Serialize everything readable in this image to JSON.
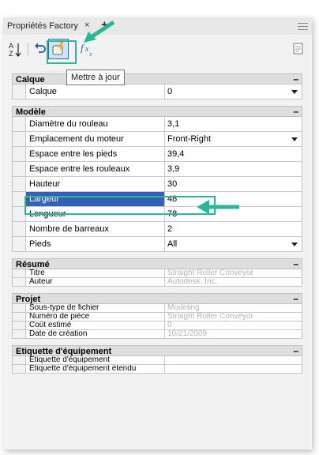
{
  "window": {
    "title": "Propriétés Factory",
    "close": "×",
    "add": "+"
  },
  "toolbar": {
    "sort_label": "A Z",
    "tooltip": "Mettre à jour"
  },
  "sections": [
    {
      "id": "calque",
      "title": "Calque",
      "collapse": "–",
      "rows": [
        {
          "name": "Calque",
          "value": "0",
          "dropdown": true
        }
      ]
    },
    {
      "id": "modele",
      "title": "Modèle",
      "collapse": "–",
      "rows": [
        {
          "name": "Diamètre du rouleau",
          "value": "3,1"
        },
        {
          "name": "Emplacement du moteur",
          "value": "Front-Right",
          "dropdown": true
        },
        {
          "name": "Espace entre les pieds",
          "value": "39,4"
        },
        {
          "name": "Espace entre les rouleaux",
          "value": "3,9"
        },
        {
          "name": "Hauteur",
          "value": "30"
        },
        {
          "name": "Largeur",
          "value": "48",
          "selected": true
        },
        {
          "name": "Longueur",
          "value": "78"
        },
        {
          "name": "Nombre de barreaux",
          "value": "2"
        },
        {
          "name": "Pieds",
          "value": "All",
          "dropdown": true
        }
      ]
    },
    {
      "id": "resume",
      "title": "Résumé",
      "collapse": "–",
      "rows": [
        {
          "name": "Titre",
          "value": "Straight Roller Conveyor",
          "grey": true
        },
        {
          "name": "Auteur",
          "value": "Autodesk, Inc.",
          "grey": true
        }
      ]
    },
    {
      "id": "projet",
      "title": "Projet",
      "collapse": "–",
      "rows": [
        {
          "name": "Sous-type de fichier",
          "value": "Modeling",
          "grey": true
        },
        {
          "name": "Numéro de pièce",
          "value": "Straight Roller Conveyor",
          "grey": true
        },
        {
          "name": "Coût estimé",
          "value": "0",
          "grey": true
        },
        {
          "name": "Date de création",
          "value": "10/21/2009",
          "grey": true
        }
      ]
    },
    {
      "id": "etiquette",
      "title": "Etiquette d'équipement",
      "collapse": "–",
      "rows": [
        {
          "name": "Etiquette d'équipement",
          "value": ""
        },
        {
          "name": "Etiquette d'équipement étendu",
          "value": ""
        }
      ]
    }
  ],
  "colors": {
    "highlight": "#2bb59a",
    "selection": "#3560b8"
  }
}
